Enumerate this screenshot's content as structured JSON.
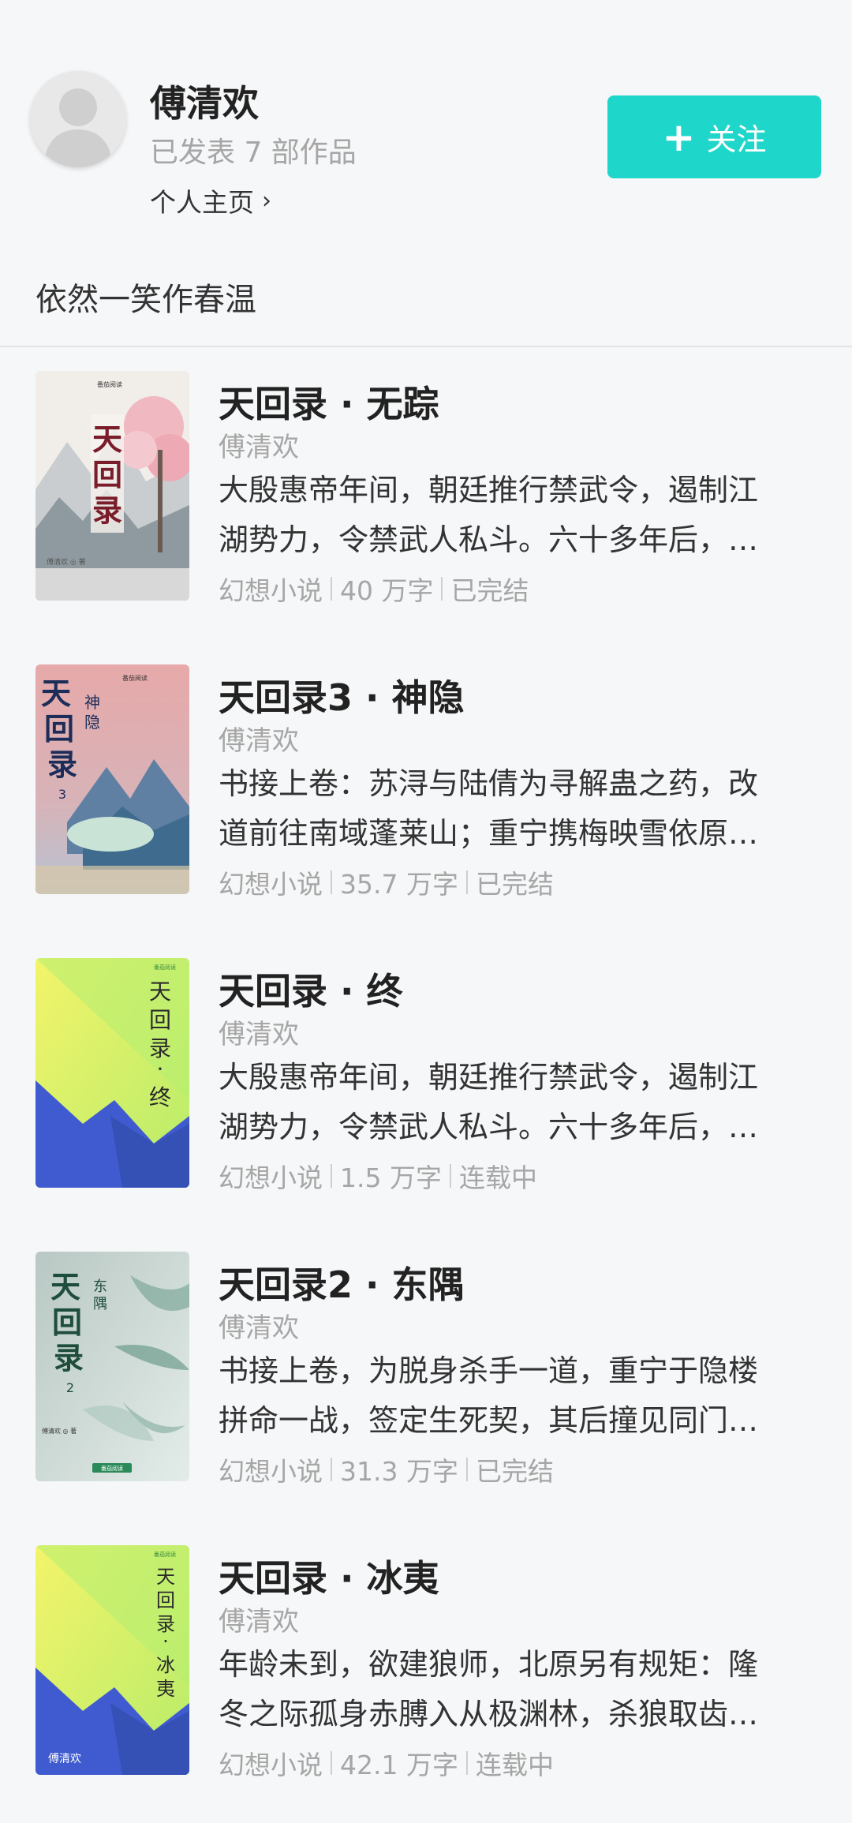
{
  "author": {
    "name": "傅清欢",
    "works_count": "已发表 7 部作品",
    "homepage_label": "个人主页",
    "follow_label": "关注",
    "bio": "依然一笑作春温"
  },
  "colors": {
    "accent": "#1ed6c9",
    "meta_gray": "#a6a6a6",
    "background": "#f6f7f8"
  },
  "books": [
    {
      "title": "天回录 · 无踪",
      "author": "傅清欢",
      "desc_line1": "大殷惠帝年间，朝廷推行禁武令，遏制江",
      "desc_line2": "湖势力，令禁武人私斗。六十多年后，…",
      "genre": "幻想小说",
      "words": "40 万字",
      "status": "已完结",
      "cover_style": "ink-painting",
      "cover_text": "天回录",
      "cover_small": "傅清欢 ◎ 著"
    },
    {
      "title": "天回录3 · 神隐",
      "author": "傅清欢",
      "desc_line1": "书接上卷：苏浔与陆倩为寻解蛊之药，改",
      "desc_line2": "道前往南域蓬莱山；重宁携梅映雪依原…",
      "genre": "幻想小说",
      "words": "35.7 万字",
      "status": "已完结",
      "cover_style": "pink-mountains",
      "cover_text": "天回录",
      "cover_small": "神隐"
    },
    {
      "title": "天回录 · 终",
      "author": "傅清欢",
      "desc_line1": "大殷惠帝年间，朝廷推行禁武令，遏制江",
      "desc_line2": "湖势力，令禁武人私斗。六十多年后，…",
      "genre": "幻想小说",
      "words": "1.5 万字",
      "status": "连载中",
      "cover_style": "yellow-green",
      "cover_text": "天回录·终",
      "cover_small": ""
    },
    {
      "title": "天回录2 · 东隅",
      "author": "傅清欢",
      "desc_line1": "书接上卷，为脱身杀手一道，重宁于隐楼",
      "desc_line2": "拼命一战，签定生死契，其后撞见同门…",
      "genre": "幻想小说",
      "words": "31.3 万字",
      "status": "已完结",
      "cover_style": "bamboo",
      "cover_text": "天回录",
      "cover_small": "东隅"
    },
    {
      "title": "天回录 · 冰夷",
      "author": "傅清欢",
      "desc_line1": "年龄未到，欲建狼师，北原另有规矩：隆",
      "desc_line2": "冬之际孤身赤膊入从极渊林，杀狼取齿…",
      "genre": "幻想小说",
      "words": "42.1 万字",
      "status": "连载中",
      "cover_style": "yellow-green",
      "cover_text": "天回录·冰夷",
      "cover_small": "傅清欢"
    }
  ]
}
